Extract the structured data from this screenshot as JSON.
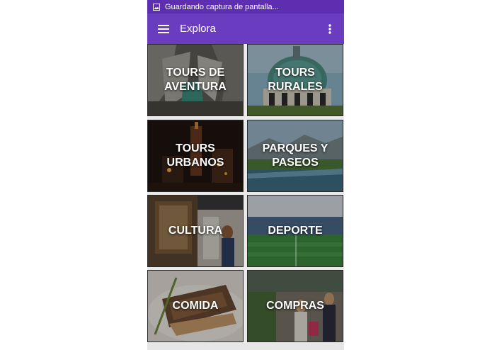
{
  "status_bar": {
    "notification_icon": "image-icon",
    "text": "Guardando captura de pantalla..."
  },
  "app_bar": {
    "menu_icon": "hamburger-menu-icon",
    "title": "Explora",
    "overflow_icon": "more-vertical-icon",
    "color": "#6a3cc0"
  },
  "categories": [
    {
      "label": "TOURS DE\nAVENTURA"
    },
    {
      "label": "TOURS\nRURALES"
    },
    {
      "label": "TOURS\nURBANOS"
    },
    {
      "label": "PARQUES Y\nPASEOS"
    },
    {
      "label": "CULTURA"
    },
    {
      "label": "DEPORTE"
    },
    {
      "label": "COMIDA"
    },
    {
      "label": "COMPRAS"
    }
  ]
}
